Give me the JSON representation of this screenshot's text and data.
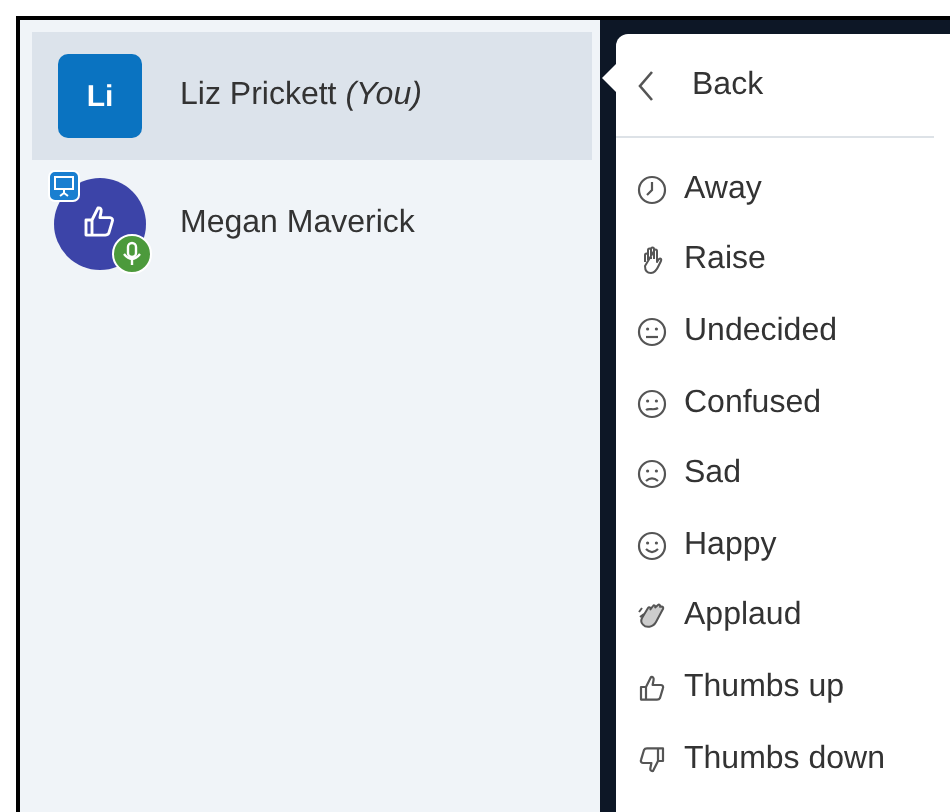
{
  "participants": [
    {
      "name": "Liz Prickett *(You)*",
      "selected": true,
      "avatar": {
        "kind": "initials",
        "text": "Li"
      }
    },
    {
      "name": "Megan Maverick",
      "selected": false,
      "avatar": {
        "kind": "thumbs-up",
        "presenter": true,
        "mic": true
      }
    }
  ],
  "menu": {
    "back": "Back",
    "items": [
      {
        "kind": "clock",
        "label": "Away"
      },
      {
        "kind": "hand",
        "label": "Raise"
      },
      {
        "kind": "neutral",
        "label": "Undecided"
      },
      {
        "kind": "confused",
        "label": "Confused"
      },
      {
        "kind": "sad",
        "label": "Sad"
      },
      {
        "kind": "happy",
        "label": "Happy"
      },
      {
        "kind": "applaud",
        "label": "Applaud"
      },
      {
        "kind": "thumbs-up",
        "label": "Thumbs up"
      },
      {
        "kind": "thumbs-down",
        "label": "Thumbs down"
      }
    ]
  }
}
